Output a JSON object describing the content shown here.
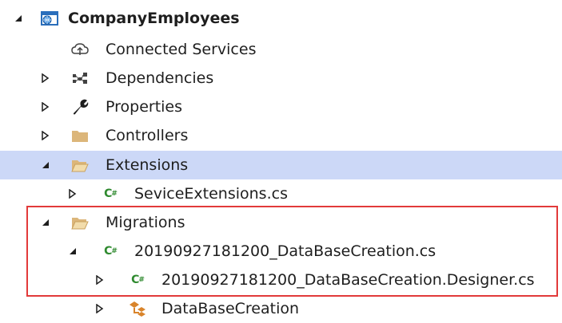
{
  "tree": {
    "project": {
      "label": "CompanyEmployees",
      "icon": "web-project-icon"
    },
    "connected_services": {
      "label": "Connected Services",
      "icon": "connected-services-icon"
    },
    "dependencies": {
      "label": "Dependencies",
      "icon": "dependencies-icon"
    },
    "properties": {
      "label": "Properties",
      "icon": "wrench-icon"
    },
    "controllers": {
      "label": "Controllers",
      "icon": "folder-icon"
    },
    "extensions": {
      "label": "Extensions",
      "icon": "open-folder-icon"
    },
    "service_extensions": {
      "label": "SeviceExtensions.cs",
      "icon": "csharp-file-icon"
    },
    "migrations": {
      "label": "Migrations",
      "icon": "open-folder-icon"
    },
    "migration_file": {
      "label": "20190927181200_DataBaseCreation.cs",
      "icon": "csharp-file-icon"
    },
    "migration_designer": {
      "label": "20190927181200_DataBaseCreation.Designer.cs",
      "icon": "csharp-file-icon"
    },
    "database_creation_class": {
      "label": "DataBaseCreation",
      "icon": "class-icon"
    }
  },
  "cs_glyph": "C",
  "cs_sharp": "#",
  "colors": {
    "selection": "#ccd8f7",
    "highlight_border": "#e23a3a",
    "csharp_green": "#2f8a2f",
    "folder_tan": "#dcb67a"
  }
}
